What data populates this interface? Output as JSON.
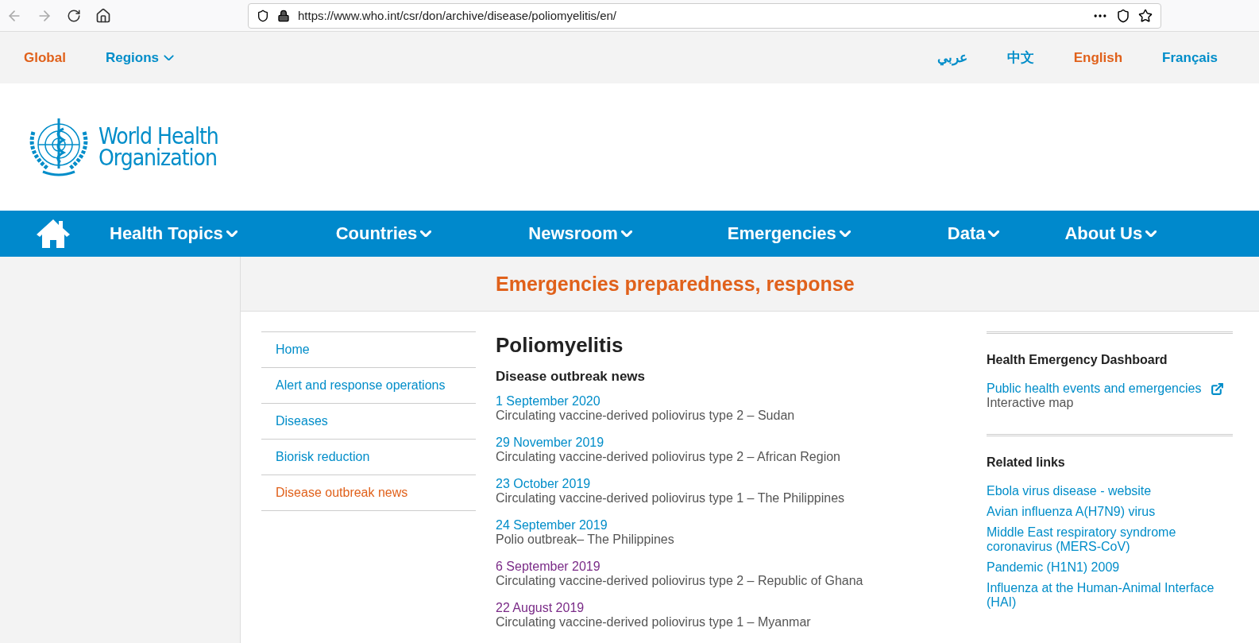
{
  "browser": {
    "url": "https://www.who.int/csr/don/archive/disease/poliomyelitis/en/"
  },
  "top_bar": {
    "links": [
      {
        "label": "Global",
        "selected": true,
        "dropdown": false
      },
      {
        "label": "Regions",
        "selected": false,
        "dropdown": true
      }
    ],
    "languages": [
      {
        "label": "عربي",
        "selected": false
      },
      {
        "label": "中文",
        "selected": false
      },
      {
        "label": "English",
        "selected": true
      },
      {
        "label": "Français",
        "selected": false
      }
    ]
  },
  "logo": {
    "line1": "World Health",
    "line2": "Organization"
  },
  "nav": {
    "items": [
      "Health Topics",
      "Countries",
      "Newsroom",
      "Emergencies",
      "Data",
      "About Us"
    ]
  },
  "section_title": "Emergencies preparedness, response",
  "sidebar": {
    "items": [
      {
        "label": "Home",
        "selected": false
      },
      {
        "label": "Alert and response operations",
        "selected": false
      },
      {
        "label": "Diseases",
        "selected": false
      },
      {
        "label": "Biorisk reduction",
        "selected": false
      },
      {
        "label": "Disease outbreak news",
        "selected": true
      }
    ]
  },
  "main": {
    "title": "Poliomyelitis",
    "subtitle": "Disease outbreak news",
    "news": [
      {
        "date": "1 September 2020",
        "text": "Circulating vaccine-derived poliovirus type 2 – Sudan",
        "visited": false
      },
      {
        "date": "29 November 2019",
        "text": "Circulating vaccine-derived poliovirus type 2 – African Region",
        "visited": false
      },
      {
        "date": "23 October 2019",
        "text": "Circulating vaccine-derived poliovirus type 1 – The Philippines",
        "visited": false
      },
      {
        "date": "24 September 2019",
        "text": "Polio outbreak– The Philippines",
        "visited": false
      },
      {
        "date": "6 September 2019",
        "text": "Circulating vaccine-derived poliovirus type 2 – Republic of Ghana",
        "visited": true
      },
      {
        "date": "22 August 2019",
        "text": "Circulating vaccine-derived poliovirus type 1 – Myanmar",
        "visited": true
      }
    ]
  },
  "aside": {
    "sections": [
      {
        "title": "Health Emergency Dashboard",
        "links": [
          {
            "label": "Public health events and emergencies",
            "external": true,
            "note": "Interactive map"
          }
        ]
      },
      {
        "title": "Related links",
        "links": [
          {
            "label": "Ebola virus disease - website",
            "external": false
          },
          {
            "label": "Avian influenza A(H7N9) virus",
            "external": false
          },
          {
            "label": "Middle East respiratory syndrome coronavirus (MERS-CoV)",
            "external": false
          },
          {
            "label": "Pandemic (H1N1) 2009",
            "external": false
          },
          {
            "label": "Influenza at the Human-Animal Interface (HAI)",
            "external": false
          }
        ]
      }
    ]
  }
}
